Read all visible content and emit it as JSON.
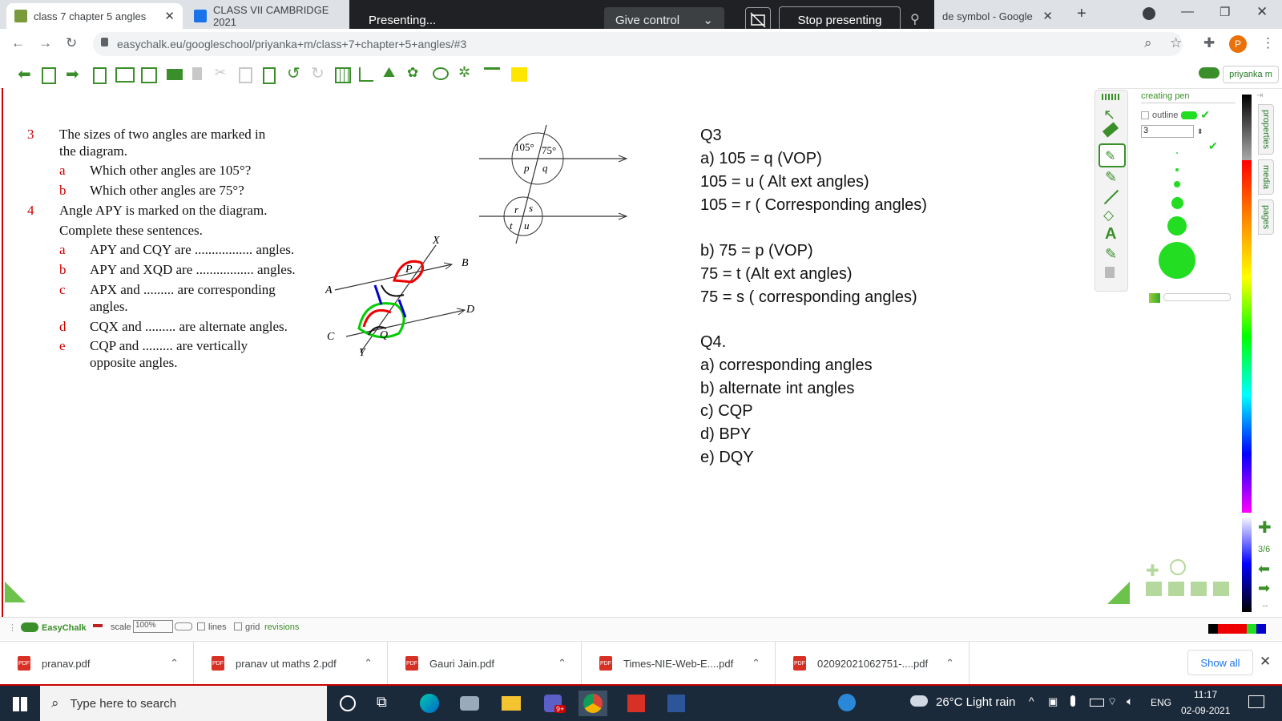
{
  "browser": {
    "tabs": [
      {
        "title": "class 7 chapter 5 angles"
      },
      {
        "title": "CLASS VII CAMBRIDGE 2021"
      },
      {
        "title": "de symbol - Google Sea"
      }
    ],
    "new_tab": "+",
    "url": "easychalk.eu/googleschool/priyanka+m/class+7+chapter+5+angles/#3",
    "profile_initial": "P"
  },
  "presenting": {
    "label": "Presenting...",
    "give_control": "Give control",
    "stop": "Stop presenting"
  },
  "app": {
    "user": "priyanka m",
    "brand": "EasyChalk"
  },
  "worksheet": {
    "q3": {
      "num": "3",
      "line1": "The sizes of two angles are marked in",
      "line2": "the diagram.",
      "a_label": "a",
      "a_text": "Which other angles are 105°?",
      "b_label": "b",
      "b_text": "Which other angles are 75°?"
    },
    "q4": {
      "num": "4",
      "line1": "Angle APY is marked on the diagram.",
      "line2": "Complete these sentences.",
      "items": [
        {
          "label": "a",
          "text": "APY and CQY are ................. angles."
        },
        {
          "label": "b",
          "text": "APY and XQD are ................. angles."
        },
        {
          "label": "c",
          "text": "APX and ......... are corresponding"
        },
        {
          "label": "",
          "text": "angles."
        },
        {
          "label": "d",
          "text": "CQX and ......... are alternate angles."
        },
        {
          "label": "e",
          "text": "CQP and ......... are vertically"
        },
        {
          "label": "",
          "text": "opposite angles."
        }
      ]
    },
    "diagram1": {
      "angle_a": "105°",
      "angle_b": "75°",
      "p": "p",
      "q": "q",
      "r": "r",
      "s": "s",
      "t": "t",
      "u": "u"
    },
    "diagram2": {
      "X": "X",
      "B": "B",
      "A": "A",
      "D": "D",
      "C": "C",
      "Y": "Y",
      "P": "P",
      "Q": "Q"
    }
  },
  "answers": {
    "lines": [
      "Q3",
      "a) 105 = q (VOP)",
      "105 = u ( Alt ext angles)",
      "105 = r ( Corresponding angles)",
      "",
      "b) 75 = p (VOP)",
      "75 = t (Alt ext angles)",
      "75 = s  ( corresponding angles)",
      "",
      "Q4.",
      "a) corresponding angles",
      "b) alternate int angles",
      "c) CQP",
      "d) BPY",
      "e) DQY"
    ]
  },
  "properties_panel": {
    "title": "creating pen",
    "outline": "outline",
    "size_value": "3",
    "page_indicator": "3/6",
    "pen_color": "#22dd22"
  },
  "side_tabs": [
    "properties",
    "media",
    "pages"
  ],
  "statusbar": {
    "scale_label": "scale",
    "scale_value": "100%",
    "lines": "lines",
    "grid": "grid",
    "revisions": "revisions"
  },
  "downloads": {
    "items": [
      "pranav.pdf",
      "pranav ut maths 2.pdf",
      "Gauri Jain.pdf",
      "Times-NIE-Web-E....pdf",
      "02092021062751-....pdf"
    ],
    "show_all": "Show all"
  },
  "taskbar": {
    "search_placeholder": "Type here to search",
    "weather": "26°C  Light rain",
    "lang": "ENG",
    "time": "11:17",
    "date": "02-09-2021",
    "teams_badge": "9+"
  }
}
